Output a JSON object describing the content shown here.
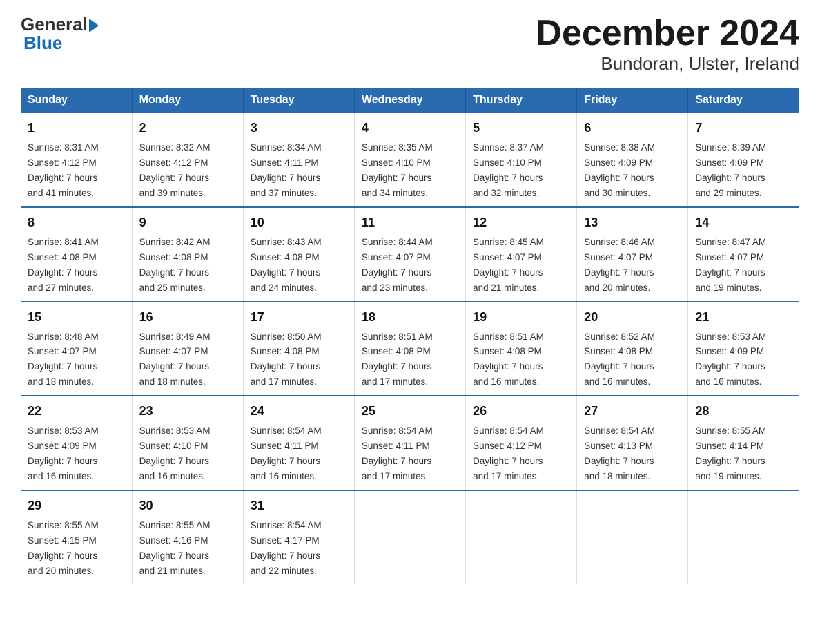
{
  "header": {
    "logo_general": "General",
    "logo_blue": "Blue",
    "title": "December 2024",
    "subtitle": "Bundoran, Ulster, Ireland"
  },
  "days_of_week": [
    "Sunday",
    "Monday",
    "Tuesday",
    "Wednesday",
    "Thursday",
    "Friday",
    "Saturday"
  ],
  "weeks": [
    [
      {
        "day": "1",
        "sunrise": "8:31 AM",
        "sunset": "4:12 PM",
        "daylight": "7 hours and 41 minutes."
      },
      {
        "day": "2",
        "sunrise": "8:32 AM",
        "sunset": "4:12 PM",
        "daylight": "7 hours and 39 minutes."
      },
      {
        "day": "3",
        "sunrise": "8:34 AM",
        "sunset": "4:11 PM",
        "daylight": "7 hours and 37 minutes."
      },
      {
        "day": "4",
        "sunrise": "8:35 AM",
        "sunset": "4:10 PM",
        "daylight": "7 hours and 34 minutes."
      },
      {
        "day": "5",
        "sunrise": "8:37 AM",
        "sunset": "4:10 PM",
        "daylight": "7 hours and 32 minutes."
      },
      {
        "day": "6",
        "sunrise": "8:38 AM",
        "sunset": "4:09 PM",
        "daylight": "7 hours and 30 minutes."
      },
      {
        "day": "7",
        "sunrise": "8:39 AM",
        "sunset": "4:09 PM",
        "daylight": "7 hours and 29 minutes."
      }
    ],
    [
      {
        "day": "8",
        "sunrise": "8:41 AM",
        "sunset": "4:08 PM",
        "daylight": "7 hours and 27 minutes."
      },
      {
        "day": "9",
        "sunrise": "8:42 AM",
        "sunset": "4:08 PM",
        "daylight": "7 hours and 25 minutes."
      },
      {
        "day": "10",
        "sunrise": "8:43 AM",
        "sunset": "4:08 PM",
        "daylight": "7 hours and 24 minutes."
      },
      {
        "day": "11",
        "sunrise": "8:44 AM",
        "sunset": "4:07 PM",
        "daylight": "7 hours and 23 minutes."
      },
      {
        "day": "12",
        "sunrise": "8:45 AM",
        "sunset": "4:07 PM",
        "daylight": "7 hours and 21 minutes."
      },
      {
        "day": "13",
        "sunrise": "8:46 AM",
        "sunset": "4:07 PM",
        "daylight": "7 hours and 20 minutes."
      },
      {
        "day": "14",
        "sunrise": "8:47 AM",
        "sunset": "4:07 PM",
        "daylight": "7 hours and 19 minutes."
      }
    ],
    [
      {
        "day": "15",
        "sunrise": "8:48 AM",
        "sunset": "4:07 PM",
        "daylight": "7 hours and 18 minutes."
      },
      {
        "day": "16",
        "sunrise": "8:49 AM",
        "sunset": "4:07 PM",
        "daylight": "7 hours and 18 minutes."
      },
      {
        "day": "17",
        "sunrise": "8:50 AM",
        "sunset": "4:08 PM",
        "daylight": "7 hours and 17 minutes."
      },
      {
        "day": "18",
        "sunrise": "8:51 AM",
        "sunset": "4:08 PM",
        "daylight": "7 hours and 17 minutes."
      },
      {
        "day": "19",
        "sunrise": "8:51 AM",
        "sunset": "4:08 PM",
        "daylight": "7 hours and 16 minutes."
      },
      {
        "day": "20",
        "sunrise": "8:52 AM",
        "sunset": "4:08 PM",
        "daylight": "7 hours and 16 minutes."
      },
      {
        "day": "21",
        "sunrise": "8:53 AM",
        "sunset": "4:09 PM",
        "daylight": "7 hours and 16 minutes."
      }
    ],
    [
      {
        "day": "22",
        "sunrise": "8:53 AM",
        "sunset": "4:09 PM",
        "daylight": "7 hours and 16 minutes."
      },
      {
        "day": "23",
        "sunrise": "8:53 AM",
        "sunset": "4:10 PM",
        "daylight": "7 hours and 16 minutes."
      },
      {
        "day": "24",
        "sunrise": "8:54 AM",
        "sunset": "4:11 PM",
        "daylight": "7 hours and 16 minutes."
      },
      {
        "day": "25",
        "sunrise": "8:54 AM",
        "sunset": "4:11 PM",
        "daylight": "7 hours and 17 minutes."
      },
      {
        "day": "26",
        "sunrise": "8:54 AM",
        "sunset": "4:12 PM",
        "daylight": "7 hours and 17 minutes."
      },
      {
        "day": "27",
        "sunrise": "8:54 AM",
        "sunset": "4:13 PM",
        "daylight": "7 hours and 18 minutes."
      },
      {
        "day": "28",
        "sunrise": "8:55 AM",
        "sunset": "4:14 PM",
        "daylight": "7 hours and 19 minutes."
      }
    ],
    [
      {
        "day": "29",
        "sunrise": "8:55 AM",
        "sunset": "4:15 PM",
        "daylight": "7 hours and 20 minutes."
      },
      {
        "day": "30",
        "sunrise": "8:55 AM",
        "sunset": "4:16 PM",
        "daylight": "7 hours and 21 minutes."
      },
      {
        "day": "31",
        "sunrise": "8:54 AM",
        "sunset": "4:17 PM",
        "daylight": "7 hours and 22 minutes."
      },
      null,
      null,
      null,
      null
    ]
  ],
  "labels": {
    "sunrise": "Sunrise:",
    "sunset": "Sunset:",
    "daylight": "Daylight:"
  }
}
